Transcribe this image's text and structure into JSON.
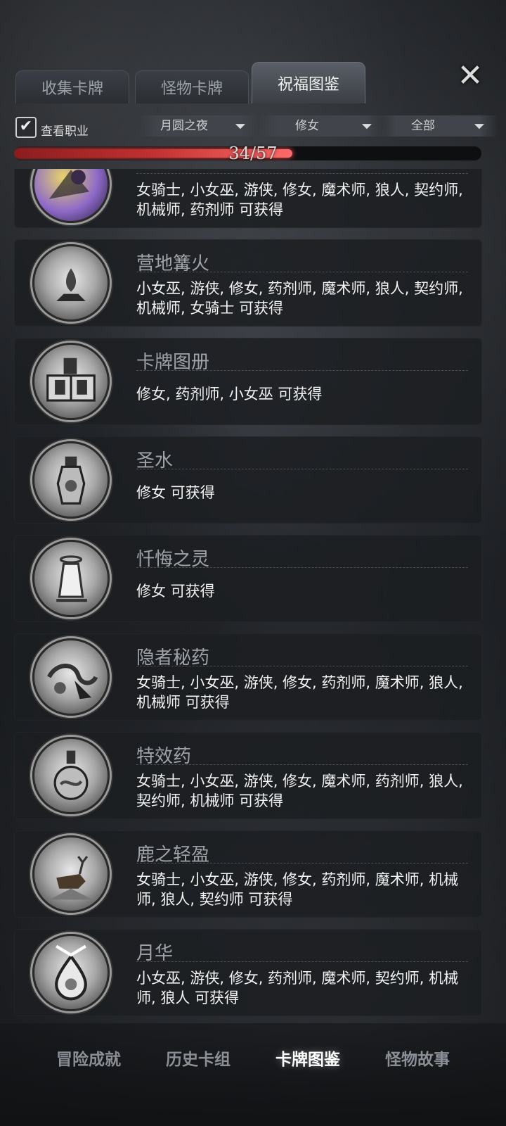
{
  "tabs": [
    {
      "label": "收集卡牌"
    },
    {
      "label": "怪物卡牌"
    },
    {
      "label": "祝福图鉴"
    }
  ],
  "close_icon": "close-x-icon",
  "filter": {
    "show_class_label": "查看职业",
    "show_class_checked": true,
    "dropdowns": [
      {
        "value": "月圆之夜"
      },
      {
        "value": "修女"
      },
      {
        "value": "全部"
      }
    ]
  },
  "progress": {
    "current": 34,
    "total": 57,
    "text": "34/57",
    "fraction": 0.596
  },
  "items": [
    {
      "title": "",
      "desc": "女骑士, 小女巫, 游侠, 修女, 魔术师, 狼人, 契约师, 机械师, 药剂师  可获得",
      "colored": true
    },
    {
      "title": "营地篝火",
      "desc": "小女巫, 游侠, 修女, 药剂师, 魔术师, 狼人, 契约师, 机械师, 女骑士  可获得"
    },
    {
      "title": "卡牌图册",
      "desc": "修女, 药剂师, 小女巫  可获得"
    },
    {
      "title": "圣水",
      "desc": "修女  可获得"
    },
    {
      "title": "忏悔之灵",
      "desc": "修女  可获得"
    },
    {
      "title": "隐者秘药",
      "desc": "女骑士, 小女巫, 游侠, 修女, 药剂师, 魔术师, 狼人, 机械师  可获得"
    },
    {
      "title": "特效药",
      "desc": "女骑士, 小女巫, 游侠, 修女, 魔术师, 药剂师, 狼人, 契约师, 机械师  可获得"
    },
    {
      "title": "鹿之轻盈",
      "desc": "女骑士, 小女巫, 游侠, 修女, 药剂师, 魔术师, 机械师, 狼人, 契约师  可获得"
    },
    {
      "title": "月华",
      "desc": "小女巫, 游侠, 修女, 药剂师, 魔术师, 契约师, 机械师, 狼人  可获得"
    }
  ],
  "bottom_nav": [
    {
      "label": "冒险成就"
    },
    {
      "label": "历史卡组"
    },
    {
      "label": "卡牌图鉴"
    },
    {
      "label": "怪物故事"
    }
  ]
}
